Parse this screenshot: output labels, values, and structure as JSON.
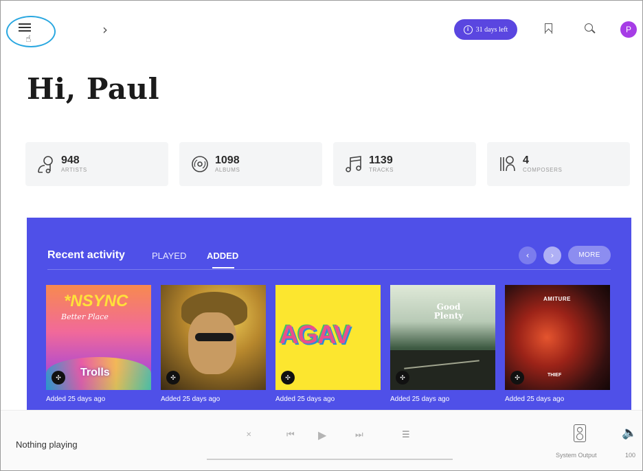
{
  "header": {
    "forward_glyph": "›",
    "trial_badge": "31 days left",
    "trial_icon_glyph": "i",
    "avatar_initial": "P",
    "cursor_glyph": "☝",
    "colors": {
      "accent": "#5a46e0",
      "avatar": "#a63de6",
      "focus_ring": "#29a7e0"
    }
  },
  "greeting": "Hi, Paul",
  "stats": [
    {
      "icon": "artist-icon",
      "count": "948",
      "label": "ARTISTS"
    },
    {
      "icon": "album-disc-icon",
      "count": "1098",
      "label": "ALBUMS"
    },
    {
      "icon": "music-note-icon",
      "count": "1139",
      "label": "TRACKS"
    },
    {
      "icon": "composer-icon",
      "count": "4",
      "label": "COMPOSERS"
    }
  ],
  "recent_activity": {
    "title": "Recent activity",
    "tabs": [
      "PLAYED",
      "ADDED"
    ],
    "active_tab": "ADDED",
    "prev_glyph": "‹",
    "next_glyph": "›",
    "more_label": "MORE",
    "background_color": "#4f50e8",
    "albums": [
      {
        "cover_text": "*NSYNC",
        "cover_subtext": "Better Place",
        "cover_bottom_text": "Trolls",
        "added": "Added 25 days ago",
        "badge": "tidal-icon"
      },
      {
        "cover_text": "",
        "added": "Added 25 days ago",
        "badge": "tidal-icon"
      },
      {
        "cover_text": "AGAV",
        "added": "Added 25 days ago",
        "badge": "tidal-icon"
      },
      {
        "cover_text": "Good Plenty",
        "added": "Added 25 days ago",
        "badge": "tidal-icon"
      },
      {
        "cover_text": "AMITURE",
        "cover_bottom_text": "THIEF",
        "added": "Added 25 days ago",
        "badge": "tidal-icon"
      }
    ]
  },
  "player": {
    "now_playing": "Nothing playing",
    "output_label": "System Output",
    "volume": "100",
    "shuffle_glyph": "✕",
    "prev_glyph": "⏮",
    "play_glyph": "▶",
    "next_glyph": "⏭",
    "queue_glyph": "☰",
    "volume_glyph": "🔈"
  }
}
